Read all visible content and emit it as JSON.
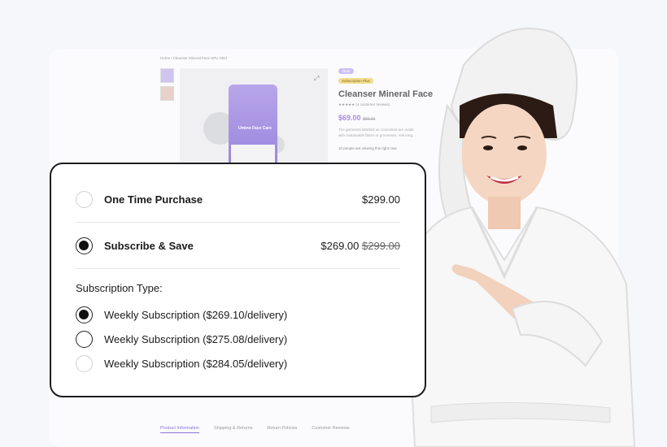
{
  "background_page": {
    "breadcrumb": "Home / Cleanser Mineral Face SPU Shirt",
    "badge_new": "New",
    "badge_subscription": "Subscription Plus",
    "product_title": "Cleanser Mineral Face",
    "rating_text": "★★★★★ (4 customer reviews)",
    "price": "$69.00",
    "old_price": "$89.00",
    "description": "The garments labelled as committed are made with sustainable fibres or processes, reducing...",
    "viewing": "10 people are viewing this right now",
    "tube_brand": "Umino Face Care",
    "tabs": [
      "Product Information",
      "Shipping & Returns",
      "Return Policies",
      "Customer Reviews"
    ]
  },
  "purchase_card": {
    "one_time": {
      "label": "One Time Purchase",
      "price": "$299.00"
    },
    "subscribe": {
      "label": "Subscribe & Save",
      "price": "$269.00",
      "old_price": "$299.00"
    },
    "subscription_type_label": "Subscription Type:",
    "subscription_options": [
      {
        "label": "Weekly Subscription ($269.10/delivery)",
        "selected": true
      },
      {
        "label": "Weekly Subscription ($275.08/delivery)",
        "selected": false
      },
      {
        "label": "Weekly Subscription ($284.05/delivery)",
        "selected": false
      }
    ]
  },
  "colors": {
    "accent": "#a98be6",
    "text": "#1b1b1d",
    "border": "#1d1d1f"
  },
  "icons": [
    "expand-icon",
    "radio-icon"
  ]
}
